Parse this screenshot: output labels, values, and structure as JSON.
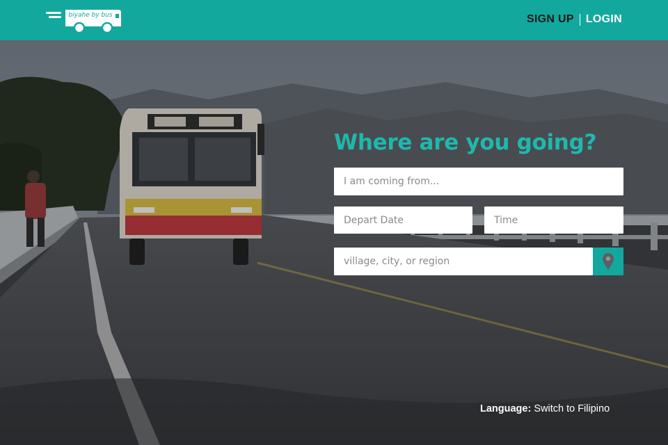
{
  "header": {
    "logo_text": "biyahe by bus",
    "signup_label": "SIGN UP",
    "login_label": "LOGIN"
  },
  "search": {
    "heading": "Where are you going?",
    "from_placeholder": "I am coming from...",
    "date_placeholder": "Depart Date",
    "time_placeholder": "Time",
    "destination_placeholder": "village, city, or region",
    "location_icon": "map-pin-icon"
  },
  "language": {
    "label": "Language:",
    "link": "Switch to Filipino"
  },
  "colors": {
    "brand": "#13a89e",
    "heading": "#1fb8ac"
  }
}
